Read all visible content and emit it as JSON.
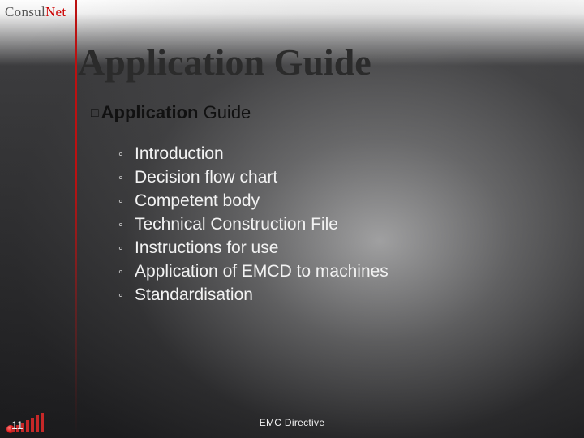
{
  "logo": {
    "part1": "Consul",
    "part2": "Net"
  },
  "title": "Application Guide",
  "subtitle": {
    "app": "Application",
    "guide": "Guide"
  },
  "items": [
    "Introduction",
    "Decision flow chart",
    "Competent body",
    "Technical Construction File",
    "Instructions for use",
    "Application of EMCD to machines",
    "Standardisation"
  ],
  "footer": {
    "text": "EMC Directive",
    "page": "11"
  }
}
